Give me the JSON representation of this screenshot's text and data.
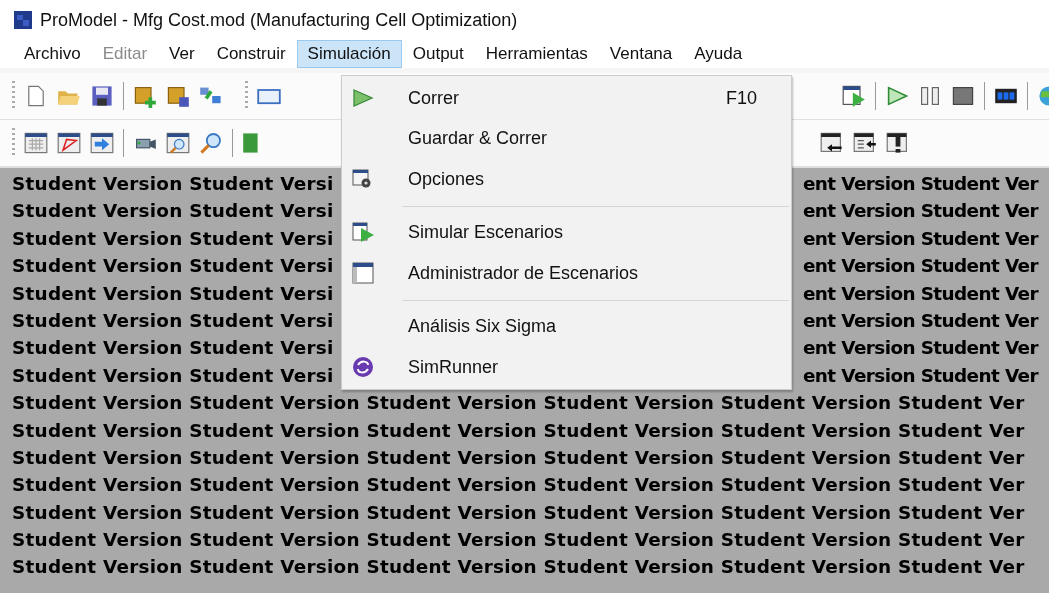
{
  "window": {
    "title": "ProModel - Mfg Cost.mod (Manufacturing Cell Optimization)"
  },
  "menu_bar": [
    {
      "label": "Archivo",
      "selected": false,
      "disabled": false
    },
    {
      "label": "Editar",
      "selected": false,
      "disabled": true
    },
    {
      "label": "Ver",
      "selected": false,
      "disabled": false
    },
    {
      "label": "Construir",
      "selected": false,
      "disabled": false
    },
    {
      "label": "Simulación",
      "selected": true,
      "disabled": false
    },
    {
      "label": "Output",
      "selected": false,
      "disabled": false
    },
    {
      "label": "Herramientas",
      "selected": false,
      "disabled": false
    },
    {
      "label": "Ventana",
      "selected": false,
      "disabled": false
    },
    {
      "label": "Ayuda",
      "selected": false,
      "disabled": false
    }
  ],
  "dropdown": [
    {
      "kind": "item",
      "label": "Correr",
      "shortcut": "F10"
    },
    {
      "kind": "item",
      "label": "Guardar & Correr"
    },
    {
      "kind": "item",
      "label": "Opciones"
    },
    {
      "kind": "separator"
    },
    {
      "kind": "item",
      "label": "Simular Escenarios"
    },
    {
      "kind": "item",
      "label": "Administrador de Escenarios"
    },
    {
      "kind": "separator"
    },
    {
      "kind": "item",
      "label": "Análisis Six Sigma"
    },
    {
      "kind": "item",
      "label": "SimRunner"
    }
  ],
  "background": {
    "rows": [
      {
        "left": "Student Version Student Versi",
        "right": "ent Version Student Ver"
      },
      {
        "left": "Student Version Student Versi",
        "right": "ent Version Student Ver"
      },
      {
        "left": "Student Version Student Versi",
        "right": "ent Version Student Ver"
      },
      {
        "left": "Student Version Student Versi",
        "right": "ent Version Student Ver"
      },
      {
        "left": "Student Version Student Versi",
        "right": "ent Version Student Ver"
      },
      {
        "left": "Student Version Student Versi",
        "right": "ent Version Student Ver"
      },
      {
        "left": "Student Version Student Versi",
        "right": "ent Version Student Ver"
      },
      {
        "left": "Student Version Student Versi",
        "right": "ent Version Student Ver"
      },
      {
        "left": "Student Version Student Version Student Version Student Version Student Version Student Ver"
      },
      {
        "left": "Student Version Student Version Student Version Student Version Student Version Student Ver"
      },
      {
        "left": "Student Version Student Version Student Version Student Version Student Version Student Ver"
      },
      {
        "left": "Student Version Student Version Student Version Student Version Student Version Student Ver"
      },
      {
        "left": "Student Version Student Version Student Version Student Version Student Version Student Ver"
      },
      {
        "left": "Student Version Student Version Student Version Student Version Student Version Student Ver"
      },
      {
        "left": "Student Version Student Version Student Version Student Version Student Version Student Ver"
      }
    ]
  }
}
